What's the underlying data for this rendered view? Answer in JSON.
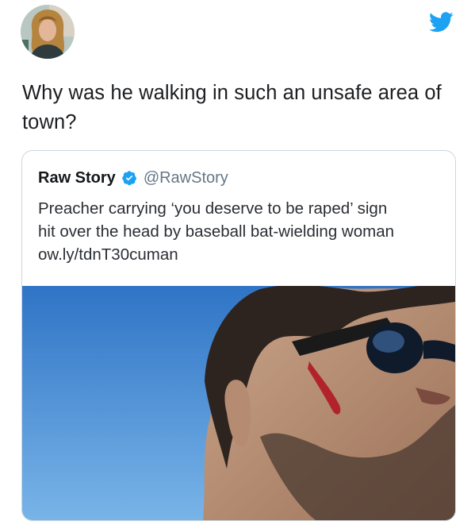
{
  "tweet": {
    "text_line1": "Why was he walking in such an unsafe area of",
    "text_line2": "town?"
  },
  "quoted_tweet": {
    "name": "Raw Story",
    "handle": "@RawStory",
    "text_line1": "Preacher carrying ‘you deserve to be raped’ sign",
    "text_line2": "hit over the head by baseball bat-wielding woman",
    "text_line3": "ow.ly/tdnT30cuman"
  },
  "icons": {
    "brand": "twitter-bird-icon",
    "verified": "verified-badge-icon"
  },
  "colors": {
    "twitter_blue": "#1da1f2",
    "handle_gray": "#657786",
    "border": "#ccd6dd"
  }
}
